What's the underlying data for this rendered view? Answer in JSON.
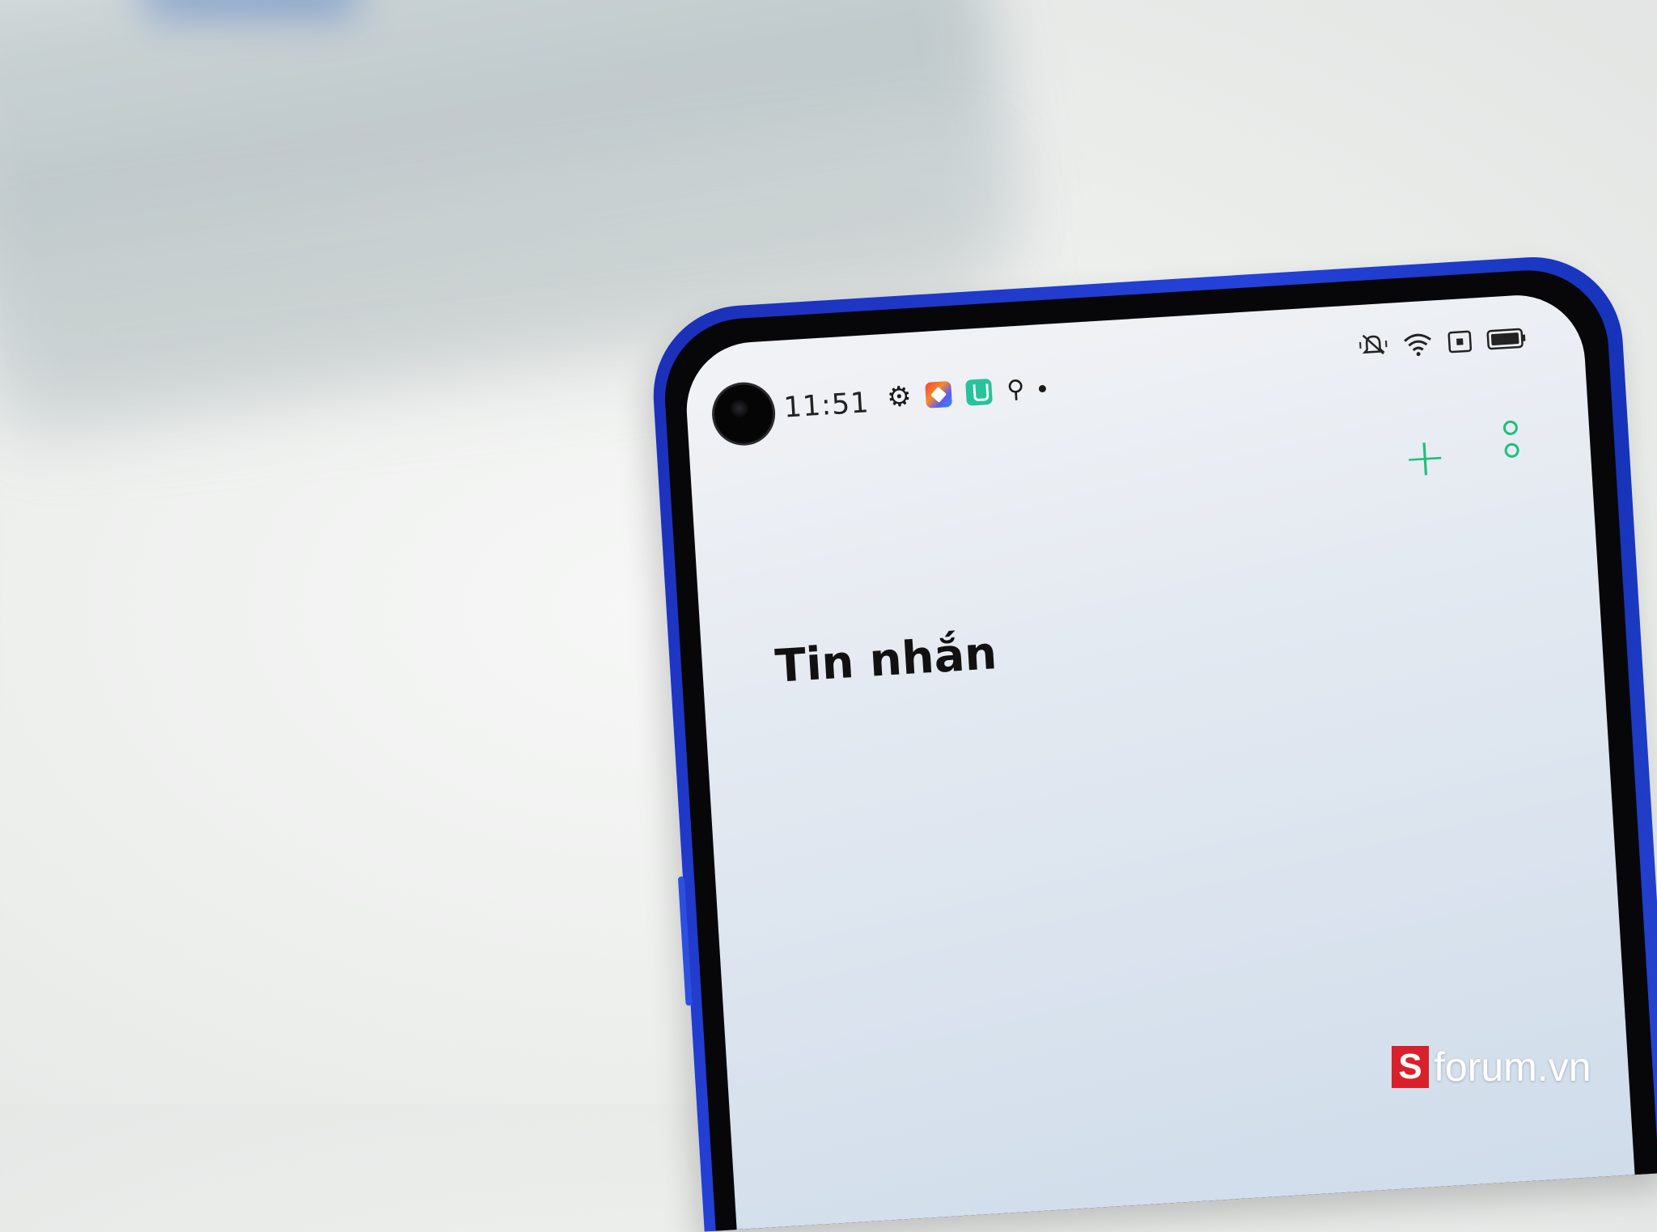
{
  "status_bar": {
    "time": "11:51",
    "left_icons": [
      "gear-icon",
      "app-icon",
      "app-icon",
      "location-icon",
      "notification-dot"
    ],
    "right_icons": [
      "mute-icon",
      "wifi-icon",
      "sim-icon",
      "battery-icon"
    ]
  },
  "app": {
    "title": "Tin nhắn",
    "accent_color": "#1fbf79"
  },
  "phone": {
    "frame_color": "#2542d9"
  },
  "watermark": {
    "logo_letter": "S",
    "text": "forum.vn"
  }
}
